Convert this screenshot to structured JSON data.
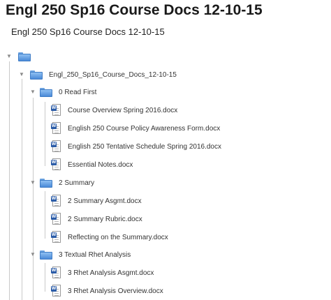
{
  "page": {
    "title": "Engl 250 Sp16 Course Docs 12-10-15",
    "subtitle": "Engl 250 Sp16 Course Docs 12-10-15"
  },
  "tree": {
    "root_label": "",
    "root_folder": "Engl_250_Sp16_Course_Docs_12-10-15",
    "folders": [
      {
        "label": "0 Read First",
        "files": [
          "Course Overview Spring 2016.docx",
          "English 250 Course Policy Awareness Form.docx",
          "English 250 Tentative Schedule Spring 2016.docx",
          "Essential Notes.docx"
        ]
      },
      {
        "label": "2 Summary",
        "files": [
          "2 Summary Asgmt.docx",
          "2 Summary Rubric.docx",
          "Reflecting on the Summary.docx"
        ]
      },
      {
        "label": "3 Textual Rhet Analysis",
        "files": [
          "3 Rhet Analysis Asgmt.docx",
          "3 Rhet Analysis Overview.docx"
        ]
      }
    ]
  },
  "icons": {
    "folder": "folder-icon",
    "word_doc": "word-doc-icon",
    "expand_arrow": "expanded-arrow-icon"
  },
  "colors": {
    "folder_blue": "#4a8ad8",
    "word_badge": "#2b5ca8"
  }
}
